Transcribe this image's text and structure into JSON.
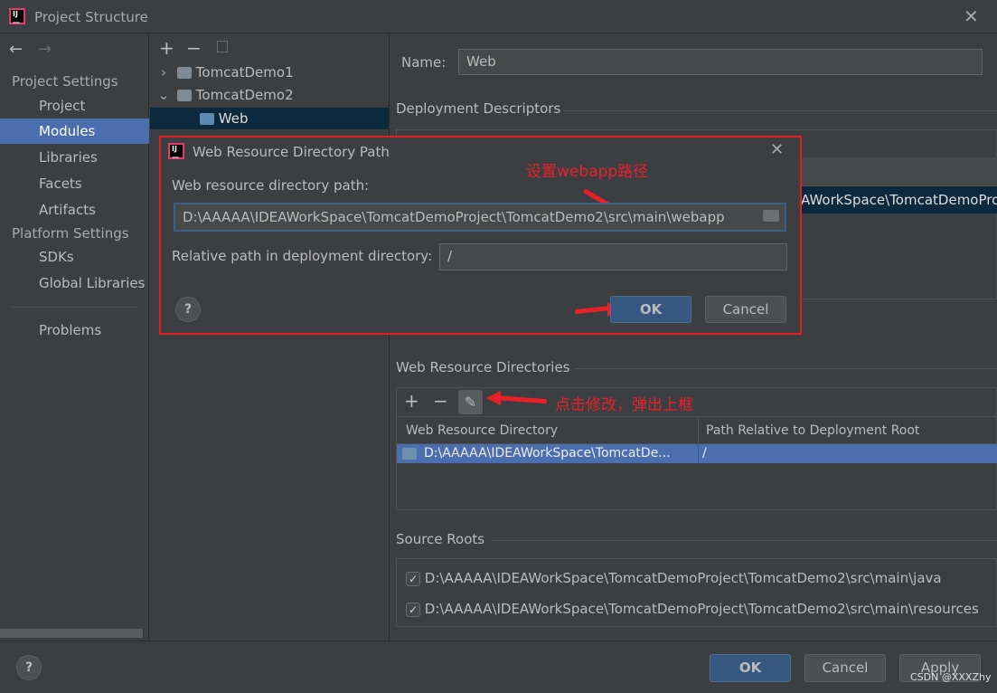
{
  "window": {
    "title": "Project Structure"
  },
  "sidebar": {
    "project_settings": "Project Settings",
    "items": [
      {
        "label": "Project"
      },
      {
        "label": "Modules"
      },
      {
        "label": "Libraries"
      },
      {
        "label": "Facets"
      },
      {
        "label": "Artifacts"
      }
    ],
    "platform_settings": "Platform Settings",
    "platform_items": [
      {
        "label": "SDKs"
      },
      {
        "label": "Global Libraries"
      }
    ],
    "problems": "Problems"
  },
  "tree": {
    "items": [
      {
        "label": "TomcatDemo1"
      },
      {
        "label": "TomcatDemo2"
      },
      {
        "label": "Web"
      }
    ]
  },
  "main": {
    "name_label": "Name:",
    "name_value": "Web",
    "deployment_descriptors": "Deployment Descriptors",
    "descriptor_row_partial": "AWorkSpace\\TomcatDemoPro",
    "web_resource_directories": "Web Resource Directories",
    "table_headers": [
      "Web Resource Directory",
      "Path Relative to Deployment Root"
    ],
    "table_rows": [
      {
        "directory": "D:\\AAAAA\\IDEAWorkSpace\\TomcatDe...",
        "path": "/"
      }
    ],
    "source_roots": "Source Roots",
    "source_root_items": [
      {
        "path": "D:\\AAAAA\\IDEAWorkSpace\\TomcatDemoProject\\TomcatDemo2\\src\\main\\java",
        "checked": true
      },
      {
        "path": "D:\\AAAAA\\IDEAWorkSpace\\TomcatDemoProject\\TomcatDemo2\\src\\main\\resources",
        "checked": true
      }
    ]
  },
  "dialog": {
    "title": "Web Resource Directory Path",
    "path_label": "Web resource directory path:",
    "path_value": "D:\\AAAAA\\IDEAWorkSpace\\TomcatDemoProject\\TomcatDemo2\\src\\main\\webapp",
    "relative_label": "Relative path in deployment directory:",
    "relative_value": "/",
    "help": "?",
    "ok": "OK",
    "cancel": "Cancel"
  },
  "annotations": {
    "set_path": "设置webapp路径",
    "click_edit": "点击修改，弹出上框"
  },
  "footer": {
    "help": "?",
    "ok": "OK",
    "cancel": "Cancel",
    "apply": "Apply",
    "watermark": "CSDN @XXXZhy"
  },
  "colors": {
    "selection": "#4b6eaf",
    "primary_button": "#365880",
    "annotation": "#e8202a"
  }
}
